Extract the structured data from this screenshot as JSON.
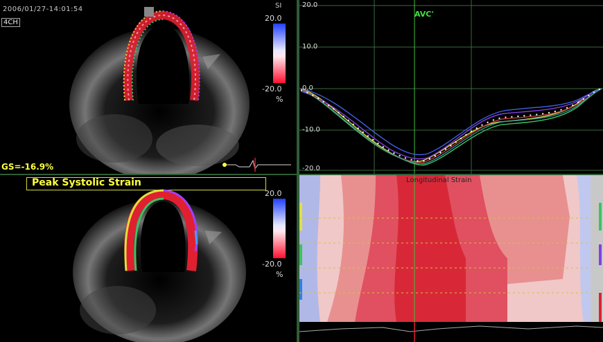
{
  "top_left": {
    "timestamp": "2006/01/27-14:01:54",
    "view_label": "4CH",
    "mode_label": "SI",
    "scale_top": "20.0",
    "scale_bottom": "-20.0",
    "scale_unit": "%",
    "global_strain": "GS=-16.9%"
  },
  "bottom_left": {
    "title": "Peak Systolic Strain",
    "scale_top": "20.0",
    "scale_bottom": "-20.0",
    "scale_unit": "%"
  },
  "top_right": {
    "marker_label": "AVC'",
    "y_ticks": [
      "20.0",
      "10.0",
      "0.0",
      "-10.0",
      "-20.0"
    ]
  },
  "bottom_right": {
    "title": "Longitudinal Strain"
  },
  "colors": {
    "divider": "#2f5d36",
    "highlight_text": "#ffff40",
    "marker_green": "#40e040",
    "strain_red": "#e02030",
    "strain_blue": "#3050e0"
  }
}
